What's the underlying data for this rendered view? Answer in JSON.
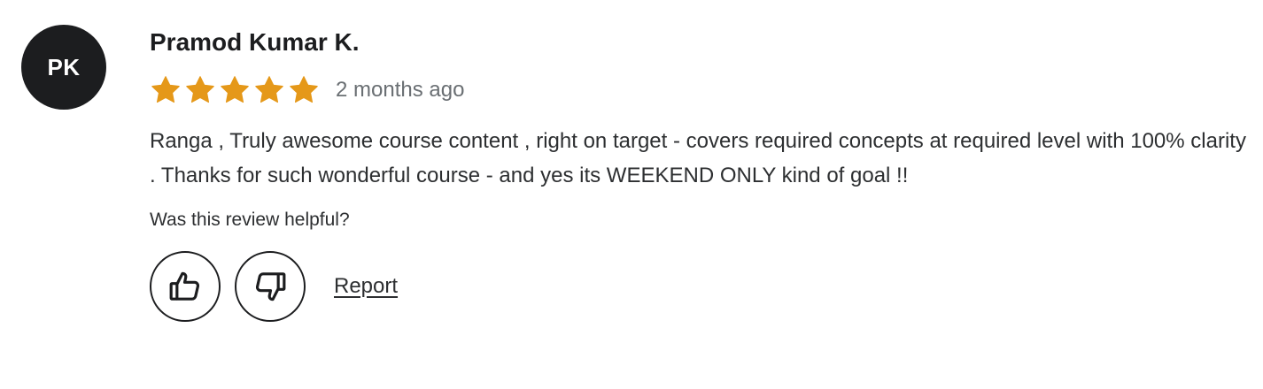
{
  "review": {
    "avatar_initials": "PK",
    "reviewer_name": "Pramod Kumar K.",
    "rating": 5,
    "rating_max": 5,
    "star_color": "#e59819",
    "date": "2 months ago",
    "text": "Ranga , Truly awesome course content , right on target - covers required concepts at required level with 100% clarity . Thanks for such wonderful course - and yes its WEEKEND ONLY kind of goal !!",
    "helpful_question": "Was this review helpful?",
    "actions": {
      "thumbs_up_icon": "thumbs-up-icon",
      "thumbs_down_icon": "thumbs-down-icon",
      "report_label": "Report"
    }
  }
}
